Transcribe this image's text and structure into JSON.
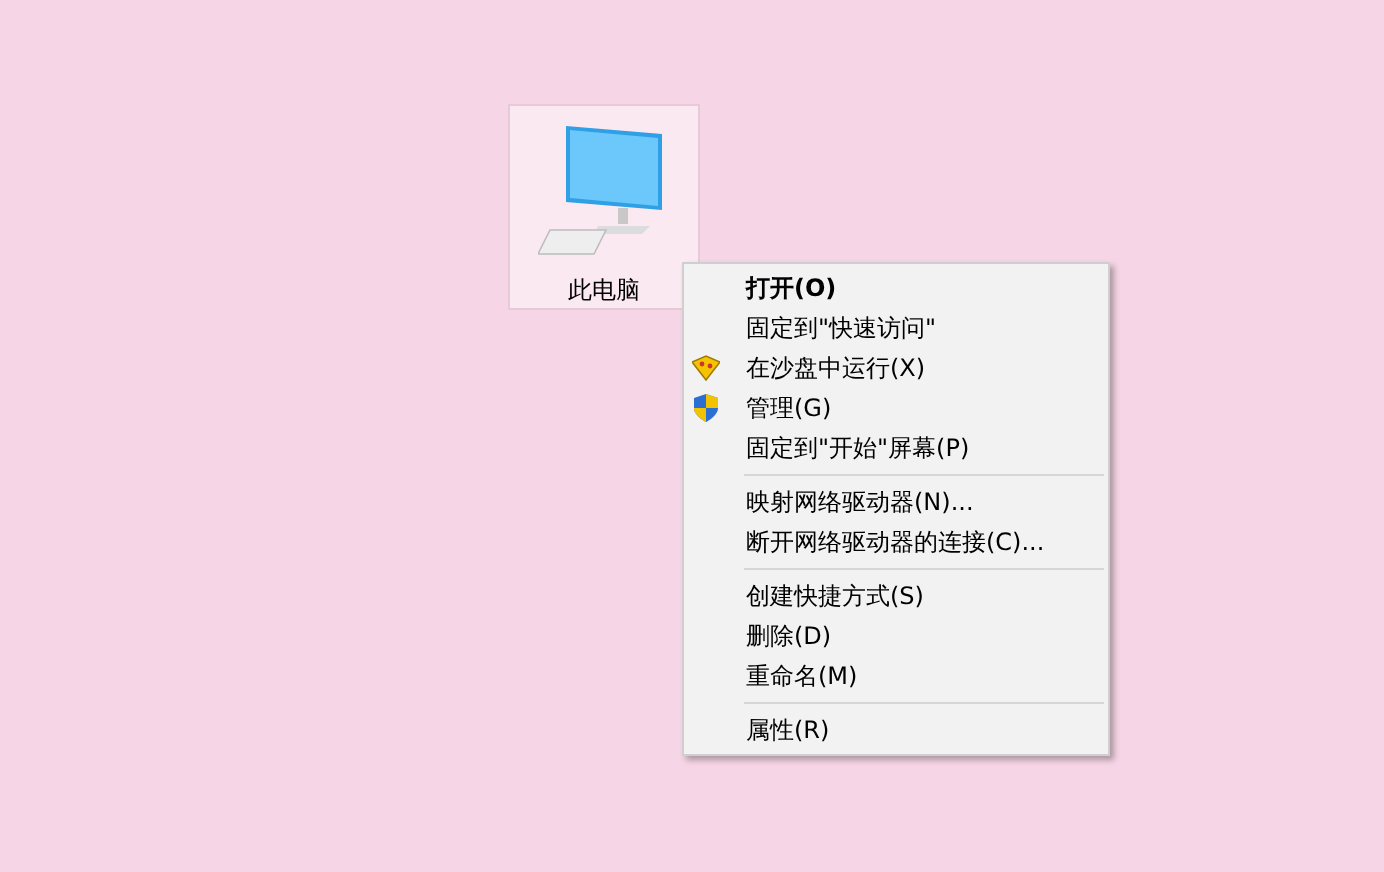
{
  "desktop_icon": {
    "label": "此电脑",
    "selected": true
  },
  "context_menu": {
    "groups": [
      {
        "items": [
          {
            "kind": "plain",
            "label": "打开(O)",
            "default": true
          },
          {
            "kind": "plain",
            "label": "固定到\"快速访问\"",
            "default": false
          },
          {
            "kind": "sandbox",
            "label": "在沙盘中运行(X)",
            "default": false
          },
          {
            "kind": "shield",
            "label": "管理(G)",
            "default": false
          },
          {
            "kind": "plain",
            "label": "固定到\"开始\"屏幕(P)",
            "default": false
          }
        ]
      },
      {
        "items": [
          {
            "kind": "plain",
            "label": "映射网络驱动器(N)...",
            "default": false
          },
          {
            "kind": "plain",
            "label": "断开网络驱动器的连接(C)...",
            "default": false
          }
        ]
      },
      {
        "items": [
          {
            "kind": "plain",
            "label": "创建快捷方式(S)",
            "default": false
          },
          {
            "kind": "plain",
            "label": "删除(D)",
            "default": false
          },
          {
            "kind": "plain",
            "label": "重命名(M)",
            "default": false
          }
        ]
      },
      {
        "items": [
          {
            "kind": "plain",
            "label": "属性(R)",
            "default": false
          }
        ]
      }
    ]
  }
}
